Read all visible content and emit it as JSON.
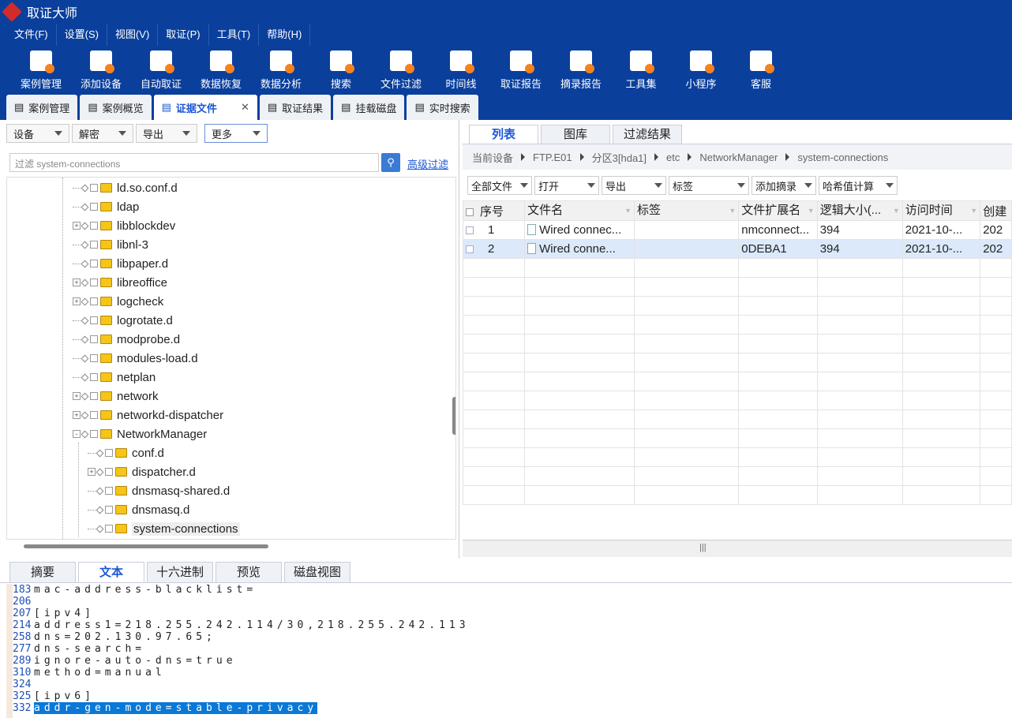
{
  "app": {
    "title": "取证大师"
  },
  "menu": [
    "文件(F)",
    "设置(S)",
    "视图(V)",
    "取证(P)",
    "工具(T)",
    "帮助(H)"
  ],
  "toolbar": [
    "案例管理",
    "添加设备",
    "自动取证",
    "数据恢复",
    "数据分析",
    "搜索",
    "文件过滤",
    "时间线",
    "取证报告",
    "摘录报告",
    "工具集",
    "小程序",
    "客服"
  ],
  "doc_tabs": [
    {
      "label": "案例管理"
    },
    {
      "label": "案例概览"
    },
    {
      "label": "证据文件",
      "active": true
    },
    {
      "label": "取证结果"
    },
    {
      "label": "挂载磁盘"
    },
    {
      "label": "实时搜索"
    }
  ],
  "left": {
    "dropdowns": [
      "设备",
      "解密",
      "导出",
      "更多"
    ],
    "filter_placeholder": "过滤 system-connections",
    "advanced": "高级过滤",
    "tree": [
      {
        "label": "ld.so.conf.d",
        "level": 0,
        "exp": ""
      },
      {
        "label": "ldap",
        "level": 0,
        "exp": ""
      },
      {
        "label": "libblockdev",
        "level": 0,
        "exp": "+"
      },
      {
        "label": "libnl-3",
        "level": 0,
        "exp": ""
      },
      {
        "label": "libpaper.d",
        "level": 0,
        "exp": ""
      },
      {
        "label": "libreoffice",
        "level": 0,
        "exp": "+"
      },
      {
        "label": "logcheck",
        "level": 0,
        "exp": "+"
      },
      {
        "label": "logrotate.d",
        "level": 0,
        "exp": ""
      },
      {
        "label": "modprobe.d",
        "level": 0,
        "exp": ""
      },
      {
        "label": "modules-load.d",
        "level": 0,
        "exp": ""
      },
      {
        "label": "netplan",
        "level": 0,
        "exp": ""
      },
      {
        "label": "network",
        "level": 0,
        "exp": "+"
      },
      {
        "label": "networkd-dispatcher",
        "level": 0,
        "exp": "+"
      },
      {
        "label": "NetworkManager",
        "level": 0,
        "exp": "-"
      },
      {
        "label": "conf.d",
        "level": 1,
        "exp": ""
      },
      {
        "label": "dispatcher.d",
        "level": 1,
        "exp": "+"
      },
      {
        "label": "dnsmasq-shared.d",
        "level": 1,
        "exp": ""
      },
      {
        "label": "dnsmasq.d",
        "level": 1,
        "exp": ""
      },
      {
        "label": "system-connections",
        "level": 1,
        "exp": "",
        "selected": true
      }
    ]
  },
  "right": {
    "tabs": [
      "列表",
      "图库",
      "过滤结果"
    ],
    "breadcrumb": [
      "当前设备",
      "FTP.E01",
      "分区3[hda1]",
      "etc",
      "NetworkManager",
      "system-connections"
    ],
    "dropdowns": [
      "全部文件",
      "打开",
      "导出",
      "标签",
      "添加摘录",
      "哈希值计算"
    ],
    "columns": [
      "序号",
      "文件名",
      "标签",
      "文件扩展名",
      "逻辑大小(...",
      "访问时间",
      "创建"
    ],
    "rows": [
      {
        "no": "1",
        "name": "Wired connec...",
        "tag": "",
        "ext": "nmconnect...",
        "size": "394",
        "atime": "2021-10-...",
        "ctime": "202"
      },
      {
        "no": "2",
        "name": "Wired conne...",
        "tag": "",
        "ext": "0DEBA1",
        "size": "394",
        "atime": "2021-10-...",
        "ctime": "202",
        "selected": true
      }
    ]
  },
  "bottom": {
    "tabs": [
      "摘要",
      "文本",
      "十六进制",
      "预览",
      "磁盘视图"
    ],
    "active_tab": 1,
    "lines": [
      {
        "n": "183",
        "t": "mac-address-blacklist="
      },
      {
        "n": "206",
        "t": ""
      },
      {
        "n": "207",
        "t": "[ipv4]"
      },
      {
        "n": "214",
        "t": "address1=218.255.242.114/30,218.255.242.113"
      },
      {
        "n": "258",
        "t": "dns=202.130.97.65;"
      },
      {
        "n": "277",
        "t": "dns-search="
      },
      {
        "n": "289",
        "t": "ignore-auto-dns=true"
      },
      {
        "n": "310",
        "t": "method=manual"
      },
      {
        "n": "324",
        "t": ""
      },
      {
        "n": "325",
        "t": "[ipv6]"
      },
      {
        "n": "332",
        "t": "addr-gen-mode=stable-privacy",
        "selected": true
      }
    ]
  }
}
